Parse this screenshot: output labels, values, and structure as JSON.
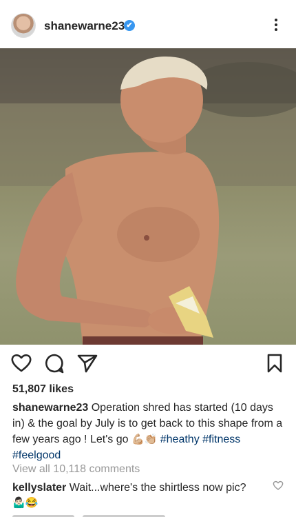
{
  "header": {
    "username": "shanewarne23",
    "verified_mark": "✔",
    "avatar_icon": "profile-avatar",
    "more_icon": "more-vertical-icon"
  },
  "post": {
    "photo_description_icon": "post-photo"
  },
  "actions": {
    "like_icon": "heart-icon",
    "comment_icon": "comment-icon",
    "share_icon": "send-icon",
    "save_icon": "bookmark-icon"
  },
  "likes": "51,807 likes",
  "caption": {
    "username": "shanewarne23",
    "text": " Operation shred has started (10 days in) & the goal by July is to get back to this shape from a few years ago ! Let's go ",
    "emojis": "💪🏼👏🏼",
    "hashtags": [
      "#heathy",
      "#fitness",
      "#feelgood"
    ]
  },
  "view_all_comments": "View all 10,118 comments",
  "comments": [
    {
      "username": "kellyslater",
      "text": " Wait...where's the shirtless now pic?",
      "emojis": "🤷🏻‍♂️😂"
    }
  ],
  "colors": {
    "text": "#262626",
    "verified": "#3897f0",
    "hashtag": "#003569",
    "muted": "#999999"
  }
}
